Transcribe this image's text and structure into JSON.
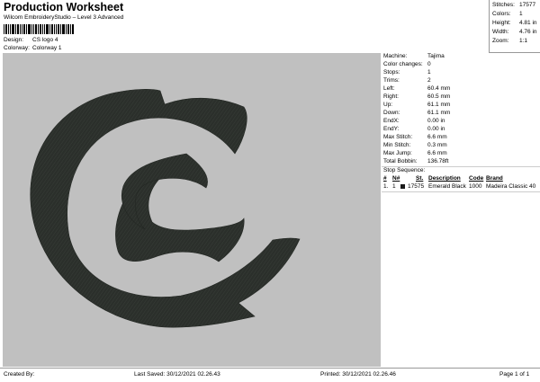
{
  "header": {
    "title": "Production Worksheet",
    "subtitle": "Wilcom EmbroideryStudio – Level 3 Advanced"
  },
  "design_info": [
    {
      "label": "Design:",
      "value": "CS logo 4"
    },
    {
      "label": "Colorway:",
      "value": "Colorway 1"
    }
  ],
  "summary_stats": [
    {
      "label": "Stitches:",
      "value": "17577"
    },
    {
      "label": "Colors:",
      "value": "1"
    },
    {
      "label": "Height:",
      "value": "4.81 in"
    },
    {
      "label": "Width:",
      "value": "4.76 in"
    },
    {
      "label": "Zoom:",
      "value": "1:1"
    }
  ],
  "machine_details": [
    {
      "label": "Machine:",
      "value": "Tajima"
    },
    {
      "label": "Color changes:",
      "value": "0"
    },
    {
      "label": "Stops:",
      "value": "1"
    },
    {
      "label": "Trims:",
      "value": "2"
    },
    {
      "label": "Left:",
      "value": "60.4 mm"
    },
    {
      "label": "Right:",
      "value": "60.5 mm"
    },
    {
      "label": "Up:",
      "value": "61.1 mm"
    },
    {
      "label": "Down:",
      "value": "61.1 mm"
    },
    {
      "label": "EndX:",
      "value": "0.00 in"
    },
    {
      "label": "EndY:",
      "value": "0.00 in"
    },
    {
      "label": "Max Stitch:",
      "value": "6.6 mm"
    },
    {
      "label": "Min Stitch:",
      "value": "0.3 mm"
    },
    {
      "label": "Max Jump:",
      "value": "6.6 mm"
    },
    {
      "label": "Total Bobbin:",
      "value": "136.78ft"
    }
  ],
  "stop_sequence": {
    "title": "Stop Sequence:",
    "headers": [
      "#",
      "N#",
      "St.",
      "Description",
      "Code",
      "Brand"
    ],
    "rows": [
      {
        "num": "1.",
        "n": "1",
        "stitches": "17575",
        "description": "Emerald Black",
        "code": "1000",
        "brand": "Madeira Classic 40",
        "color": "#1a1a1a"
      }
    ]
  },
  "design": {
    "background_color": "#c0c0c0",
    "thread_color": "#2b2f2b"
  },
  "footer": {
    "created_by": "Created By:",
    "last_saved": "Last Saved: 30/12/2021 02.26.43",
    "printed": "Printed: 30/12/2021 02.26.46",
    "page": "Page 1 of 1"
  }
}
